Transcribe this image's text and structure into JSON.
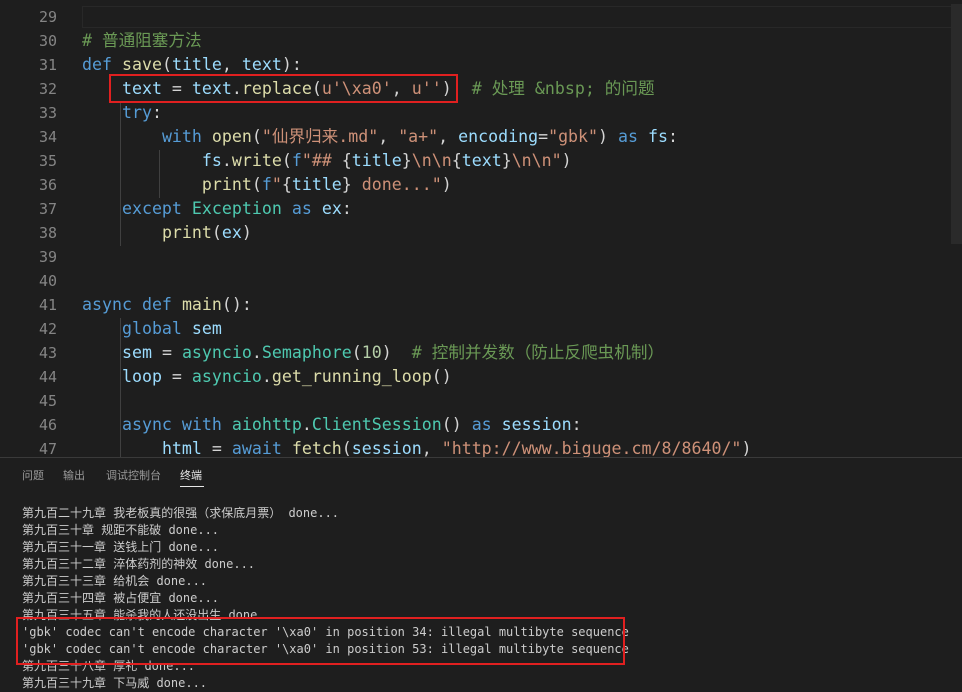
{
  "editor": {
    "line_numbers": [
      "29",
      "30",
      "31",
      "32",
      "33",
      "34",
      "35",
      "36",
      "37",
      "38",
      "39",
      "40",
      "41",
      "42",
      "43",
      "44",
      "45",
      "46",
      "47"
    ],
    "comment_30": "# 普通阻塞方法",
    "comment_32": "# 处理 &nbsp; 的问题",
    "comment_43": "# 控制并发数（防止反爬虫机制）",
    "filename": "\"仙界归来.md\"",
    "url": "\"http://www.biguge.cm/8/8640/\""
  },
  "panel": {
    "tabs": [
      "问题",
      "输出",
      "调试控制台",
      "终端"
    ],
    "active_tab": "终端",
    "terminal_lines": [
      "第九百二十九章 我老板真的很强（求保底月票） done...",
      "第九百三十章 规距不能破 done...",
      "第九百三十一章 送钱上门 done...",
      "第九百三十二章 淬体药剂的神效 done...",
      "第九百三十三章 给机会 done...",
      "第九百三十四章 被占便宜 done...",
      "第九百三十五章 能杀我的人还没出生 done...",
      "'gbk' codec can't encode character '\\xa0' in position 34: illegal multibyte sequence",
      "'gbk' codec can't encode character '\\xa0' in position 53: illegal multibyte sequence",
      "第九百三十八章 厚礼 done...",
      "第九百三十九章 下马威 done..."
    ]
  },
  "colors": {
    "highlight_box": "#e02020",
    "keyword": "#569cd6",
    "string": "#ce9178",
    "comment": "#6a9955",
    "function": "#dcdcaa",
    "variable": "#9cdcfe"
  }
}
